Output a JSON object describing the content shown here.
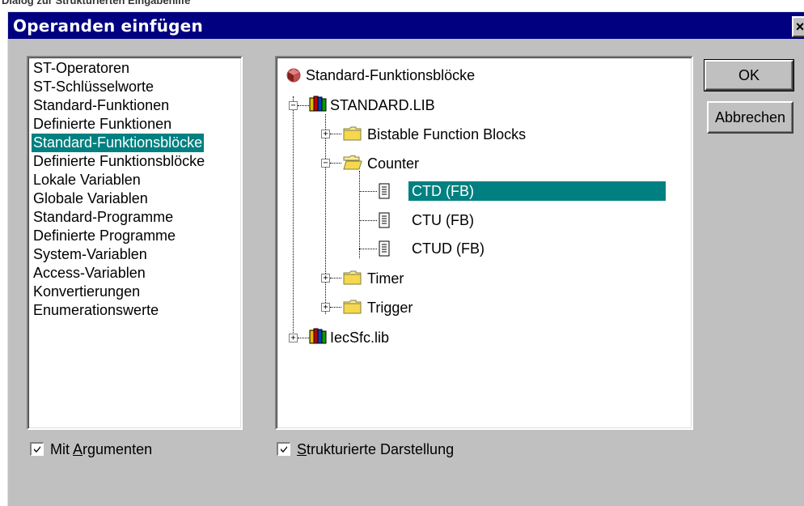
{
  "caption": "Dialog zur Strukturierten Eingabehilfe",
  "window": {
    "title": "Operanden einfügen",
    "close_label": "×"
  },
  "categories": {
    "selected_index": 4,
    "items": [
      "ST-Operatoren",
      "ST-Schlüsselworte",
      "Standard-Funktionen",
      "Definierte Funktionen",
      "Standard-Funktionsblöcke",
      "Definierte Funktionsblöcke",
      "Lokale Variablen",
      "Globale Variablen",
      "Standard-Programme",
      "Definierte Programme",
      "System-Variablen",
      "Access-Variablen",
      "Konvertierungen",
      "Enumerationswerte"
    ]
  },
  "tree": {
    "root": "Standard-Funktionsblöcke",
    "lib1": "STANDARD.LIB",
    "folder_bistable": "Bistable Function Blocks",
    "folder_counter": "Counter",
    "item_ctd": "CTD (FB)",
    "item_ctu": "CTU (FB)",
    "item_ctud": "CTUD (FB)",
    "folder_timer": "Timer",
    "folder_trigger": "Trigger",
    "lib2": "IecSfc.lib",
    "expand_plus": "+",
    "expand_minus": "−"
  },
  "buttons": {
    "ok": "OK",
    "cancel": "Abbrechen"
  },
  "options": {
    "mit_argumenten": {
      "label_prefix": "Mit ",
      "label_underlined": "A",
      "label_rest": "rgumenten",
      "checked": true
    },
    "strukturierte": {
      "label_underlined": "S",
      "label_rest": "trukturierte Darstellung",
      "checked": true
    }
  },
  "colors": {
    "titlebar": "#000080",
    "selection": "#008080",
    "face": "#c0c0c0"
  },
  "icons": {
    "root": "function-block-icon",
    "library": "library-books-icon",
    "folder": "folder-icon",
    "open_folder": "open-folder-icon",
    "pou": "document-icon"
  }
}
